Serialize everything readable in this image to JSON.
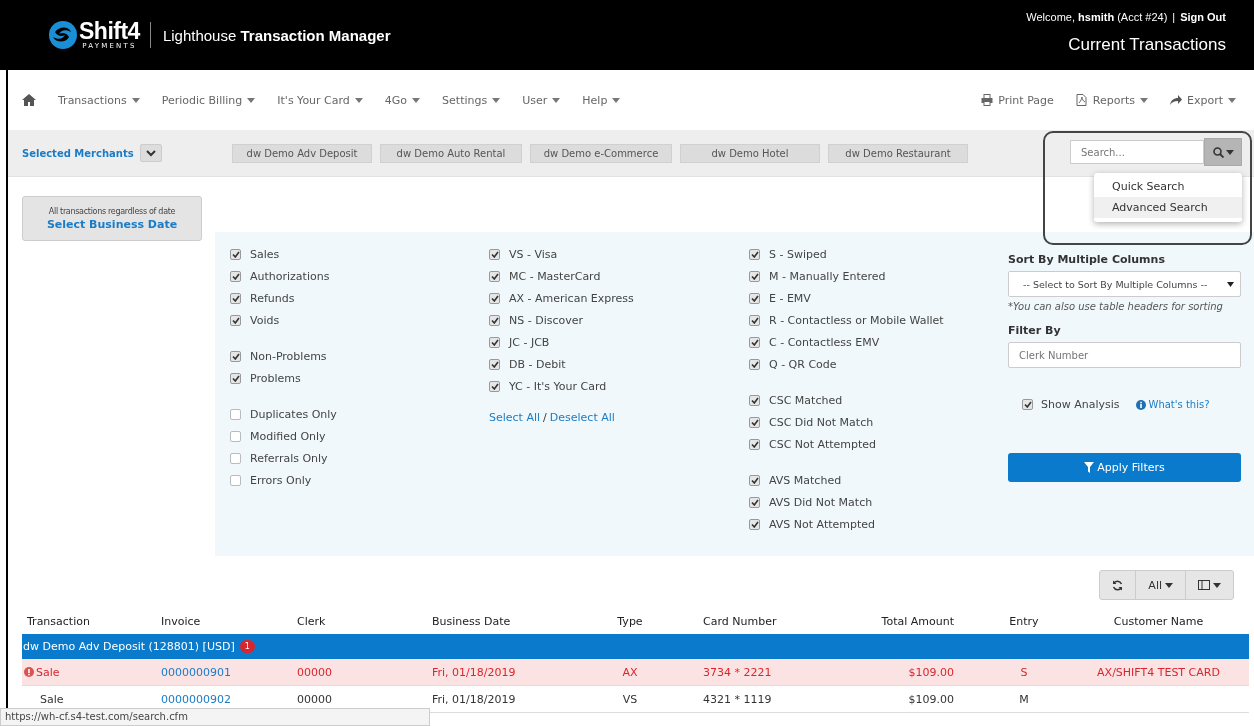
{
  "header": {
    "logo": "Shift4",
    "logo_sub": "PAYMENTS",
    "app_title": "Lighthouse **Transaction Manager**",
    "welcome": "Welcome, **hsmith** (Acct #24)",
    "separator": "|",
    "sign_out": "Sign Out",
    "page_title": "Current Transactions"
  },
  "nav": {
    "left": [
      {
        "label": "Transactions",
        "dropdown": true
      },
      {
        "label": "Periodic Billing",
        "dropdown": true
      },
      {
        "label": "It's Your Card",
        "dropdown": true
      },
      {
        "label": "4Go",
        "dropdown": true
      },
      {
        "label": "Settings",
        "dropdown": true
      },
      {
        "label": "User",
        "dropdown": true
      },
      {
        "label": "Help",
        "dropdown": true
      }
    ],
    "right": [
      {
        "label": "Print Page",
        "kind": "print",
        "dropdown": false
      },
      {
        "label": "Reports",
        "kind": "report",
        "dropdown": true
      },
      {
        "label": "Export",
        "kind": "export",
        "dropdown": true
      }
    ]
  },
  "merchants": {
    "label": "Selected Merchants",
    "chips": [
      "dw Demo Adv Deposit",
      "dw Demo Auto Rental",
      "dw Demo e-Commerce",
      "dw Demo Hotel",
      "dw Demo Restaurant"
    ]
  },
  "search": {
    "placeholder": "Search...",
    "menu": [
      {
        "label": "Quick Search",
        "selected": false
      },
      {
        "label": "Advanced Search",
        "selected": true
      }
    ]
  },
  "business_date": {
    "note": "All transactions regardless of date",
    "button": "Select Business Date"
  },
  "filters": {
    "columns": [
      {
        "groups": [
          [
            {
              "label": "Sales",
              "checked": true
            },
            {
              "label": "Authorizations",
              "checked": true
            },
            {
              "label": "Refunds",
              "checked": true
            },
            {
              "label": "Voids",
              "checked": true
            }
          ],
          [
            {
              "label": "Non-Problems",
              "checked": true
            },
            {
              "label": "Problems",
              "checked": true
            }
          ],
          [
            {
              "label": "Duplicates Only",
              "checked": false
            },
            {
              "label": "Modified Only",
              "checked": false
            },
            {
              "label": "Referrals Only",
              "checked": false
            },
            {
              "label": "Errors Only",
              "checked": false
            }
          ]
        ]
      },
      {
        "groups": [
          [
            {
              "label": "VS - Visa",
              "checked": true
            },
            {
              "label": "MC - MasterCard",
              "checked": true
            },
            {
              "label": "AX - American Express",
              "checked": true
            },
            {
              "label": "NS - Discover",
              "checked": true
            },
            {
              "label": "JC - JCB",
              "checked": true
            },
            {
              "label": "DB - Debit",
              "checked": true
            },
            {
              "label": "YC - It's Your Card",
              "checked": true
            }
          ]
        ],
        "select_all": "Select All",
        "slash": "/",
        "deselect_all": "Deselect All"
      },
      {
        "groups": [
          [
            {
              "label": "S - Swiped",
              "checked": true
            },
            {
              "label": "M - Manually Entered",
              "checked": true
            },
            {
              "label": "E - EMV",
              "checked": true
            },
            {
              "label": "R - Contactless or Mobile Wallet",
              "checked": true
            },
            {
              "label": "C - Contactless EMV",
              "checked": true
            },
            {
              "label": "Q - QR Code",
              "checked": true
            }
          ],
          [
            {
              "label": "CSC Matched",
              "checked": true
            },
            {
              "label": "CSC Did Not Match",
              "checked": true
            },
            {
              "label": "CSC Not Attempted",
              "checked": true
            }
          ],
          [
            {
              "label": "AVS Matched",
              "checked": true
            },
            {
              "label": "AVS Did Not Match",
              "checked": true
            },
            {
              "label": "AVS Not Attempted",
              "checked": true
            }
          ]
        ]
      }
    ]
  },
  "sort": {
    "label": "Sort By Multiple Columns",
    "value": "-- Select to Sort By Multiple Columns --",
    "hint": "*You can also use table headers for sorting"
  },
  "filter_by": {
    "label": "Filter By",
    "placeholder": "Clerk Number"
  },
  "show_analysis": {
    "label": "Show Analysis",
    "checked": true,
    "help": "What's this?"
  },
  "apply_button": "Apply Filters",
  "table_toolbar": {
    "all": "All"
  },
  "table": {
    "columns": [
      "Transaction",
      "Invoice",
      "Clerk",
      "Business Date",
      "Type",
      "Card Number",
      "Total Amount",
      "Entry",
      "Customer Name"
    ],
    "groups": [
      {
        "title": "dw Demo Adv Deposit (128801) [USD]",
        "badge": "1",
        "rows": [
          {
            "problem": true,
            "transaction": "Sale",
            "invoice": "0000000901",
            "clerk": "00000",
            "date": "Fri, 01/18/2019",
            "type": "AX",
            "card": "3734 * 2221",
            "amount": "$109.00",
            "entry": "S",
            "customer": "AX/SHIFT4 TEST CARD"
          },
          {
            "problem": false,
            "transaction": "Sale",
            "invoice": "0000000902",
            "clerk": "00000",
            "date": "Fri, 01/18/2019",
            "type": "VS",
            "card": "4321 * 1119",
            "amount": "$109.00",
            "entry": "M"
          }
        ]
      }
    ]
  },
  "status_url": "https://wh-cf.s4-test.com/search.cfm"
}
